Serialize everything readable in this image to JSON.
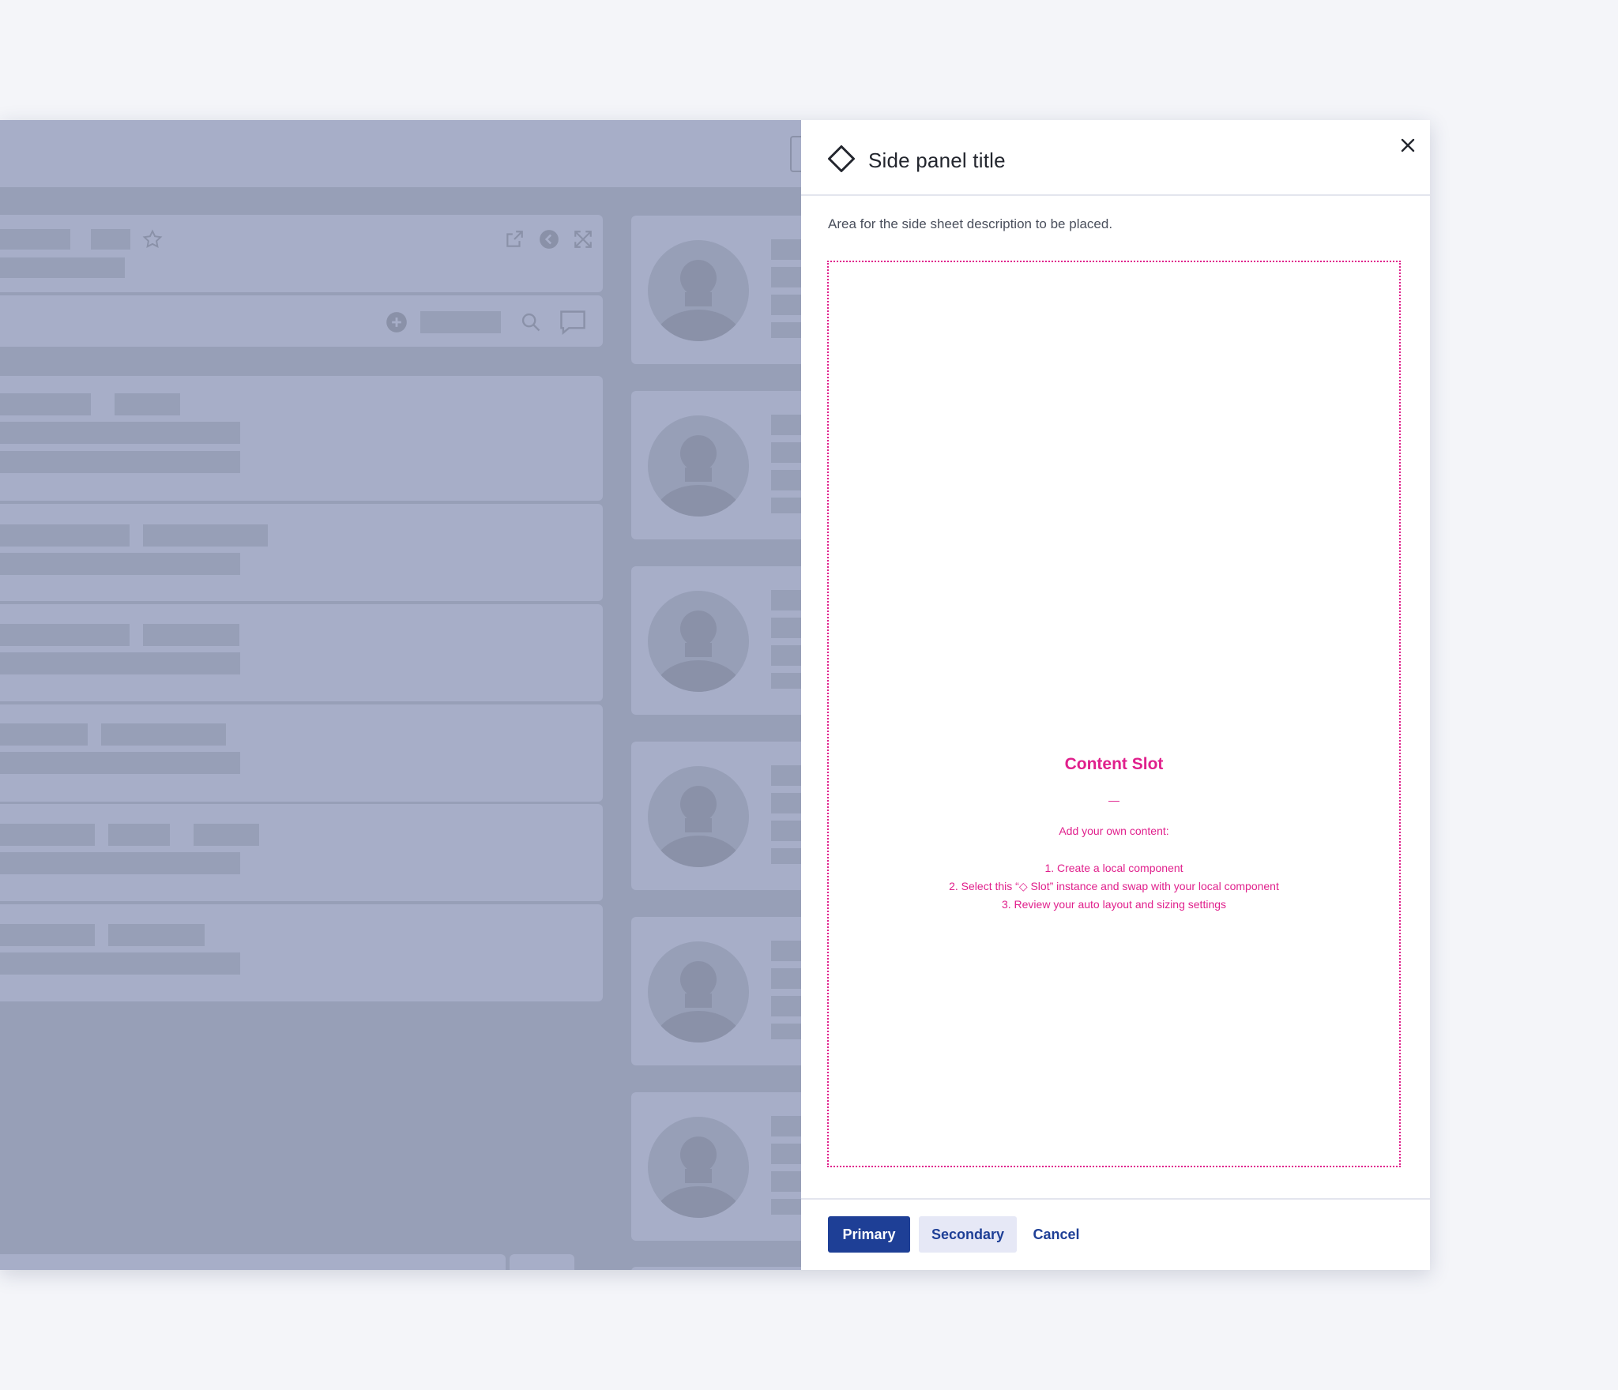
{
  "panel": {
    "title": "Side panel title",
    "description": "Area for the side sheet description to be placed.",
    "title_icon": "diamond-icon",
    "close_icon": "close-icon"
  },
  "slot": {
    "title": "Content Slot",
    "dash": "—",
    "intro": "Add your own content:",
    "steps": [
      "1. Create a local component",
      "2. Select this “◇ Slot” instance and swap with your local component",
      "3. Review your auto layout and sizing settings"
    ],
    "accent_color": "#e0208c"
  },
  "footer": {
    "primary_label": "Primary",
    "secondary_label": "Secondary",
    "cancel_label": "Cancel"
  },
  "background_icons": [
    "star-icon",
    "external-link-icon",
    "back-icon",
    "expand-icon",
    "add-icon",
    "search-icon",
    "comment-icon",
    "avatar-icon"
  ],
  "colors": {
    "brand": "#1e3f96",
    "overlay": "#979fb7",
    "page_bg": "#f4f5f9"
  }
}
